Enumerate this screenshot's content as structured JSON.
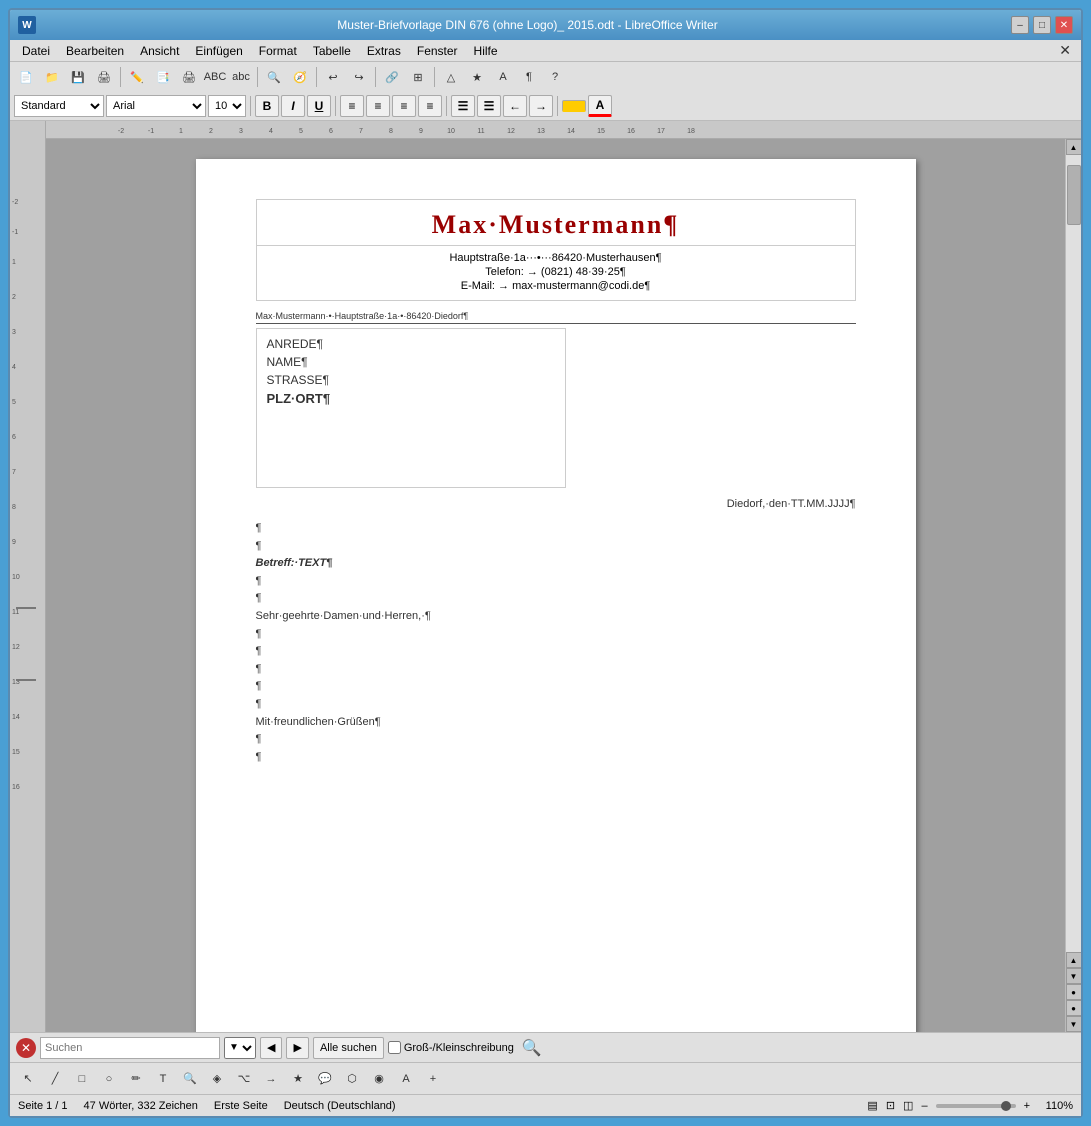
{
  "window": {
    "title": "Muster-Briefvorlage DIN 676 (ohne Logo)_ 2015.odt - LibreOffice Writer",
    "icon_label": "LO"
  },
  "titlebar": {
    "minimize": "–",
    "maximize": "□",
    "close": "✕"
  },
  "menubar": {
    "items": [
      "Datei",
      "Bearbeiten",
      "Ansicht",
      "Einfügen",
      "Format",
      "Tabelle",
      "Extras",
      "Fenster",
      "Hilfe"
    ],
    "close_btn": "✕"
  },
  "toolbar": {
    "style_value": "Standard",
    "font_value": "Arial",
    "size_value": "10",
    "bold": "B",
    "italic": "I",
    "underline": "U"
  },
  "document": {
    "header": {
      "name": "Max·Mustermann¶",
      "address": "Hauptstraße·1a···•···86420·Musterhausen¶",
      "phone": "Telefon: → (0821) 48·39·25¶",
      "email": "E-Mail: → max-mustermann@codi.de¶"
    },
    "sender_small": "Max·Mustermann·•·Hauptstraße·1a·•·86420·Diedorf¶",
    "recipient": {
      "line1": "ANREDE¶",
      "line2": "NAME¶",
      "line3": "STRASSE¶",
      "line4": "PLZ·ORT¶"
    },
    "date": "Diedorf,·den·TT.MM.JJJJ¶",
    "body": {
      "p1": "¶",
      "p2": "¶",
      "subject": "Betreff:·TEXT¶",
      "p3": "¶",
      "p4": "¶",
      "salutation": "Sehr·geehrte·Damen·und·Herren,·¶",
      "p5": "¶",
      "p6": "¶",
      "p7": "¶",
      "p8": "¶",
      "p9": "¶",
      "closing": "Mit·freundlichen·Grüßen¶",
      "p10": "¶",
      "p11": "¶"
    }
  },
  "search": {
    "placeholder": "Suchen",
    "all_btn": "Alle suchen",
    "case_label": "Groß-/Kleinschreibung"
  },
  "status": {
    "page": "Seite 1 / 1",
    "words": "47 Wörter, 332 Zeichen",
    "style": "Erste Seite",
    "lang": "Deutsch (Deutschland)",
    "zoom": "110%"
  },
  "ruler": {
    "marks": [
      "-2",
      "-1",
      "1",
      "2",
      "3",
      "4",
      "5",
      "6",
      "7",
      "8",
      "9",
      "10",
      "11",
      "12",
      "13",
      "14",
      "15",
      "16",
      "17",
      "18"
    ]
  }
}
